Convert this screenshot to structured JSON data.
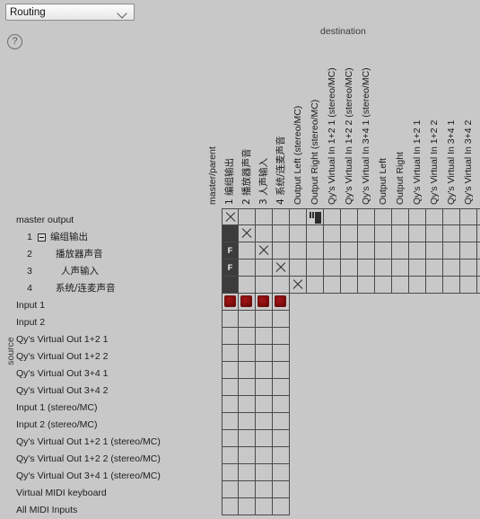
{
  "window": {
    "mode_select": {
      "value": "Routing",
      "chevron_icon": "chevron-down-icon"
    },
    "help_icon": "?",
    "destination_label": "destination",
    "source_label": "source"
  },
  "colors": {
    "background": "#c8c8c8",
    "grid_line": "#4a4a4a",
    "dark_cell": "#3c3c3c",
    "red_dot": "#8d0f0f",
    "text": "#1d1d1d"
  },
  "columns": [
    {
      "label": "master/parent",
      "cjk": false
    },
    {
      "label": "1  编组输出",
      "cjk": true
    },
    {
      "label": "2   播放器声音",
      "cjk": true
    },
    {
      "label": "3   人声输入",
      "cjk": true
    },
    {
      "label": "4  系统/连麦声音",
      "cjk": true
    },
    {
      "label": "Output Left (stereo/MC)",
      "cjk": false
    },
    {
      "label": "Output Right (stereo/MC)",
      "cjk": false
    },
    {
      "label": "Qy's Virtual In 1+2 1 (stereo/MC)",
      "cjk": false
    },
    {
      "label": "Qy's Virtual In 1+2 2 (stereo/MC)",
      "cjk": false
    },
    {
      "label": "Qy's Virtual In 3+4 1 (stereo/MC)",
      "cjk": false
    },
    {
      "label": "Output Left",
      "cjk": false
    },
    {
      "label": "Output Right",
      "cjk": false
    },
    {
      "label": "Qy's Virtual In 1+2 1",
      "cjk": false
    },
    {
      "label": "Qy's Virtual In 1+2 2",
      "cjk": false
    },
    {
      "label": "Qy's Virtual In 3+4 1",
      "cjk": false
    },
    {
      "label": "Qy's Virtual In 3+4 2",
      "cjk": false
    }
  ],
  "rows": [
    {
      "num": "",
      "label": "master output",
      "indent": 18,
      "expander": false,
      "cjk": false
    },
    {
      "num": "1",
      "label": "编组输出",
      "indent": 56,
      "expander": true,
      "cjk": true
    },
    {
      "num": "2",
      "label": "播放器声音",
      "indent": 62,
      "expander": false,
      "cjk": true
    },
    {
      "num": "3",
      "label": "人声输入",
      "indent": 68,
      "expander": false,
      "cjk": true
    },
    {
      "num": "4",
      "label": "系统/连麦声音",
      "indent": 62,
      "expander": false,
      "cjk": true
    },
    {
      "num": "",
      "label": "Input 1",
      "indent": 18,
      "expander": false,
      "cjk": false
    },
    {
      "num": "",
      "label": "Input 2",
      "indent": 18,
      "expander": false,
      "cjk": false
    },
    {
      "num": "",
      "label": "Qy's Virtual Out 1+2 1",
      "indent": 18,
      "expander": false,
      "cjk": false
    },
    {
      "num": "",
      "label": "Qy's Virtual Out 1+2 2",
      "indent": 18,
      "expander": false,
      "cjk": false
    },
    {
      "num": "",
      "label": "Qy's Virtual Out 3+4 1",
      "indent": 18,
      "expander": false,
      "cjk": false
    },
    {
      "num": "",
      "label": "Qy's Virtual Out 3+4 2",
      "indent": 18,
      "expander": false,
      "cjk": false
    },
    {
      "num": "",
      "label": "Input 1 (stereo/MC)",
      "indent": 18,
      "expander": false,
      "cjk": false
    },
    {
      "num": "",
      "label": "Input 2 (stereo/MC)",
      "indent": 18,
      "expander": false,
      "cjk": false
    },
    {
      "num": "",
      "label": "Qy's Virtual Out 1+2 1 (stereo/MC)",
      "indent": 18,
      "expander": false,
      "cjk": false
    },
    {
      "num": "",
      "label": "Qy's Virtual Out 1+2 2 (stereo/MC)",
      "indent": 18,
      "expander": false,
      "cjk": false
    },
    {
      "num": "",
      "label": "Qy's Virtual Out 3+4 1 (stereo/MC)",
      "indent": 18,
      "expander": false,
      "cjk": false
    },
    {
      "num": "",
      "label": "Virtual MIDI keyboard",
      "indent": 18,
      "expander": false,
      "cjk": false
    },
    {
      "num": "",
      "label": "All MIDI Inputs",
      "indent": 18,
      "expander": false,
      "cjk": false
    }
  ],
  "matrix": {
    "cell_size": 19,
    "cells": [
      {
        "cols": 16,
        "states": [
          "x",
          "",
          "",
          "",
          "",
          "kbd",
          "",
          "",
          "",
          "",
          "",
          "",
          "",
          "",
          "",
          ""
        ]
      },
      {
        "cols": 16,
        "states": [
          "dark",
          "x",
          "",
          "",
          "",
          "",
          "",
          "",
          "",
          "",
          "",
          "",
          "",
          "",
          "",
          ""
        ]
      },
      {
        "cols": 16,
        "states": [
          "darkF",
          "",
          "x",
          "",
          "",
          "",
          "",
          "",
          "",
          "",
          "",
          "",
          "",
          "",
          "",
          " "
        ]
      },
      {
        "cols": 16,
        "states": [
          "darkF",
          "",
          "",
          "x",
          "",
          "",
          "",
          "",
          "",
          "",
          "",
          "",
          "",
          "",
          "",
          ""
        ]
      },
      {
        "cols": 16,
        "states": [
          "dark",
          "",
          "",
          "",
          "x",
          "",
          "",
          "",
          "",
          "",
          "",
          "",
          "",
          "",
          "",
          ""
        ]
      },
      {
        "cols": 4,
        "states": [
          "red",
          "red",
          "red",
          "red"
        ]
      },
      {
        "cols": 4,
        "states": [
          "",
          "",
          "",
          ""
        ]
      },
      {
        "cols": 4,
        "states": [
          "",
          "",
          "",
          ""
        ]
      },
      {
        "cols": 4,
        "states": [
          "",
          "",
          "",
          ""
        ]
      },
      {
        "cols": 4,
        "states": [
          "",
          "",
          "",
          ""
        ]
      },
      {
        "cols": 4,
        "states": [
          "",
          "",
          "",
          ""
        ]
      },
      {
        "cols": 4,
        "states": [
          "",
          "",
          "",
          ""
        ]
      },
      {
        "cols": 4,
        "states": [
          "",
          "",
          "",
          ""
        ]
      },
      {
        "cols": 4,
        "states": [
          "",
          "",
          "",
          ""
        ]
      },
      {
        "cols": 4,
        "states": [
          "",
          "",
          "",
          ""
        ]
      },
      {
        "cols": 4,
        "states": [
          "",
          "",
          "",
          ""
        ]
      },
      {
        "cols": 4,
        "states": [
          "",
          "",
          "",
          ""
        ]
      },
      {
        "cols": 4,
        "states": [
          "",
          "",
          "",
          ""
        ]
      }
    ]
  }
}
